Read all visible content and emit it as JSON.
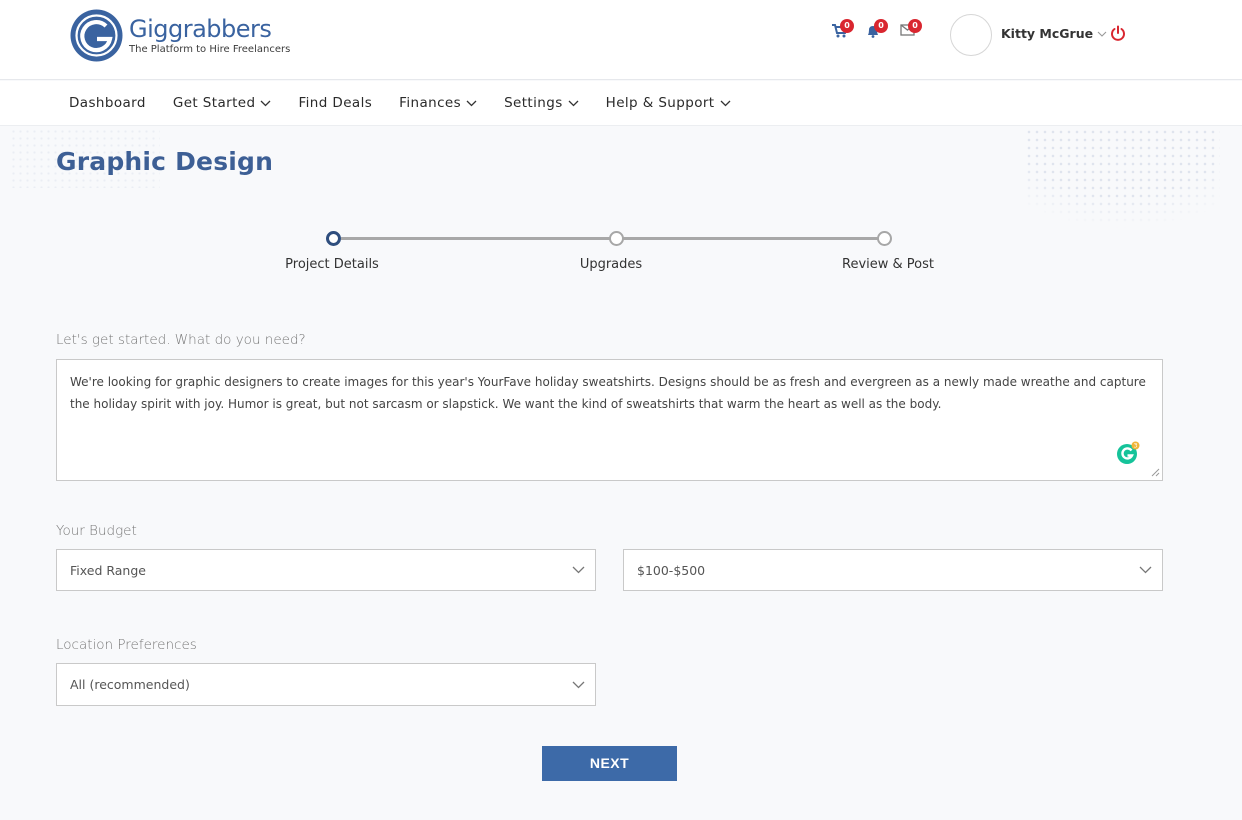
{
  "brand": {
    "name": "Giggrabbers",
    "tagline": "The Platform to Hire Freelancers",
    "color": "#3a63a0"
  },
  "header": {
    "icons": [
      {
        "name": "cart-icon",
        "badge": "0"
      },
      {
        "name": "bell-icon",
        "badge": "0"
      },
      {
        "name": "envelope-icon",
        "badge": "0"
      }
    ],
    "user_name": "Kitty McGrue",
    "badge_color": "#d9262f",
    "power_color": "#d9262f"
  },
  "nav": {
    "items": [
      {
        "label": "Dashboard",
        "dropdown": false
      },
      {
        "label": "Get Started",
        "dropdown": true
      },
      {
        "label": "Find Deals",
        "dropdown": false
      },
      {
        "label": "Finances",
        "dropdown": true
      },
      {
        "label": "Settings",
        "dropdown": true
      },
      {
        "label": "Help & Support",
        "dropdown": true
      }
    ]
  },
  "page": {
    "title": "Graphic Design"
  },
  "stepper": {
    "steps": [
      {
        "label": "Project Details",
        "active": true
      },
      {
        "label": "Upgrades",
        "active": false
      },
      {
        "label": "Review & Post",
        "active": false
      }
    ]
  },
  "form": {
    "description_label": "Let's get started. What do you need?",
    "description_value": "We're looking for graphic designers to create images for this year's YourFave holiday sweatshirts. Designs should be as fresh and evergreen as a newly made wreathe and capture the holiday spirit with joy. Humor is great, but not sarcasm or slapstick. We want the kind of sweatshirts that warm the heart as well as the body.",
    "grammarly_count": "3",
    "budget_label": "Your Budget",
    "budget_type": "Fixed Range",
    "budget_range": "$100-$500",
    "location_label": "Location Preferences",
    "location_value": "All (recommended)",
    "next_label": "NEXT"
  }
}
